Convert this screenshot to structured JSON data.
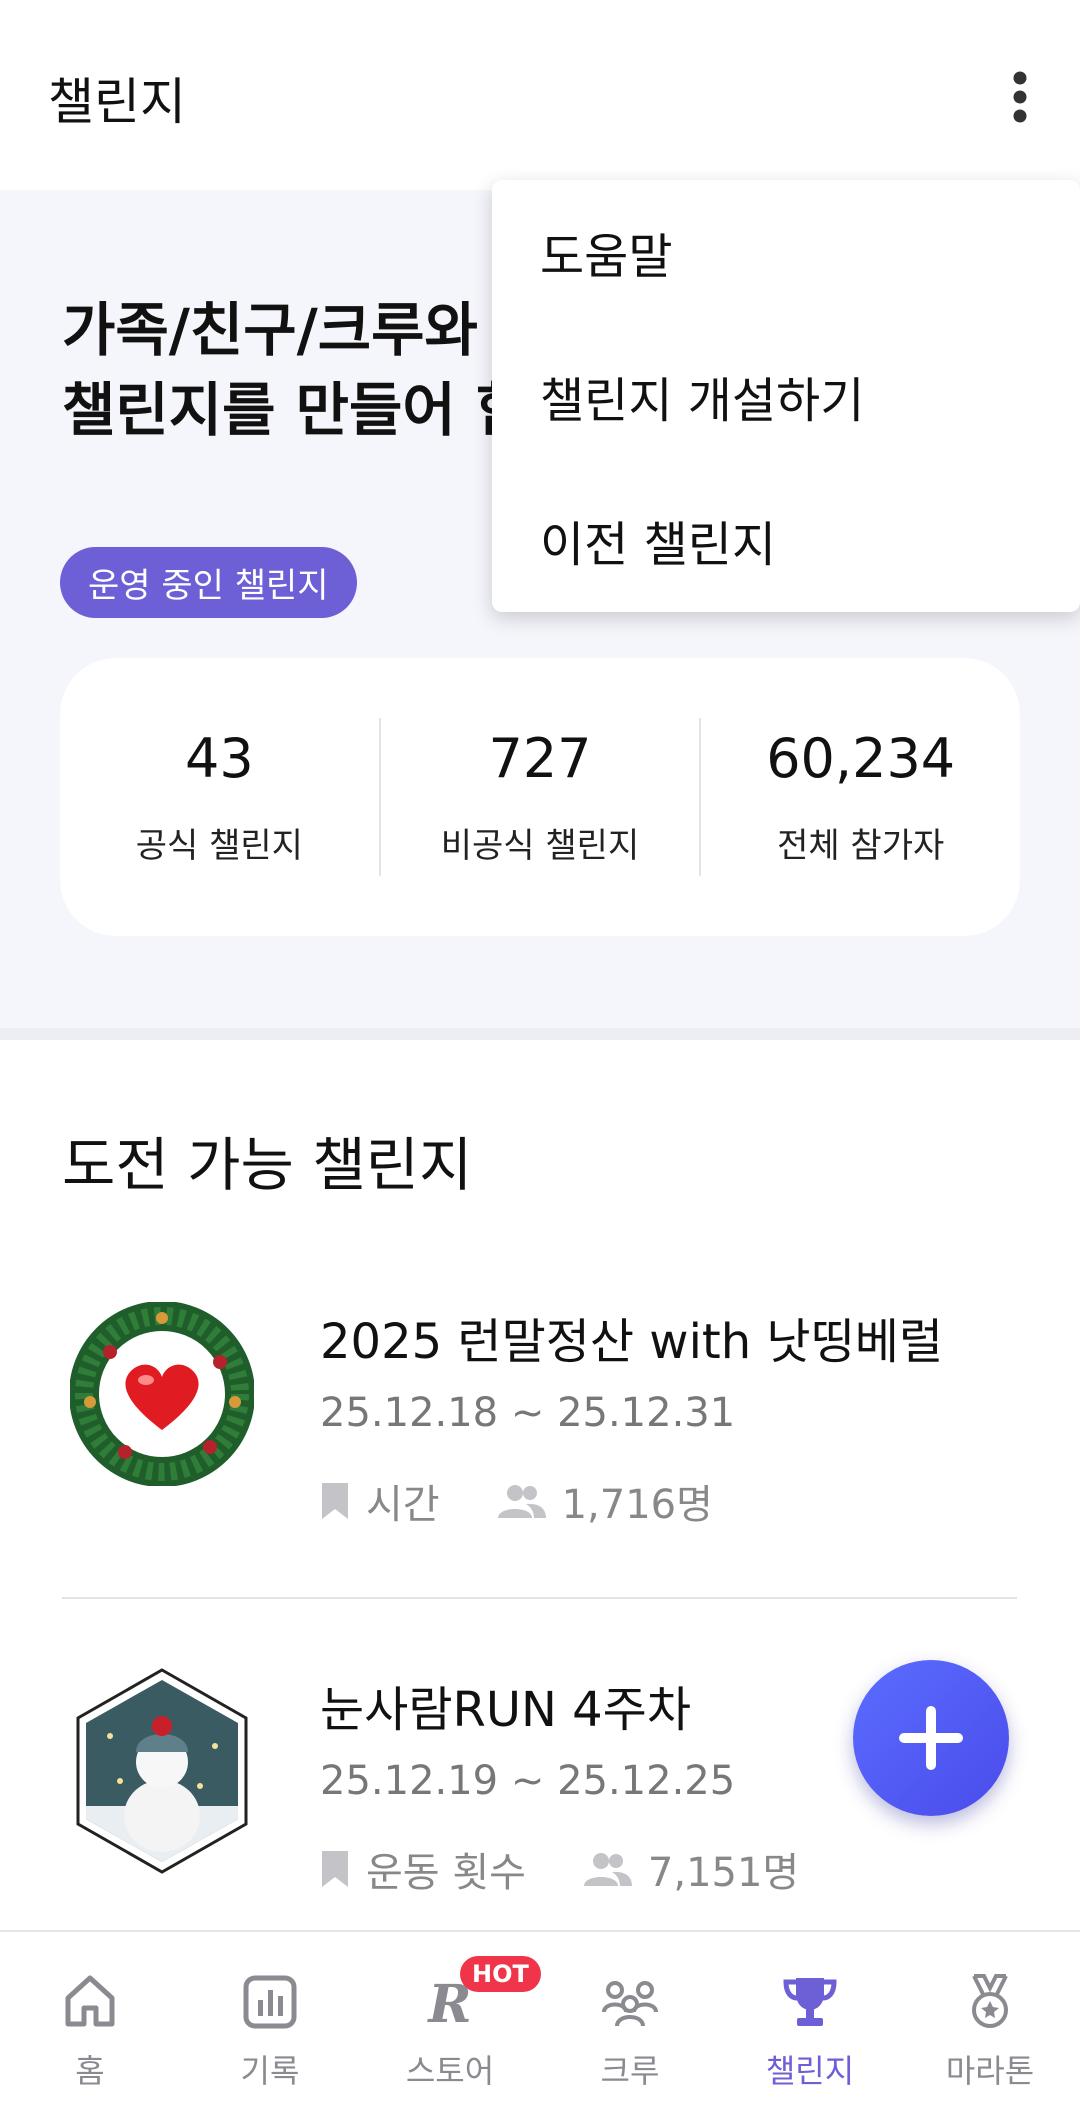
{
  "appbar": {
    "title": "챌린지",
    "more_icon": "more-vertical-icon"
  },
  "hero": {
    "headline_line1": "가족/친구/크루와",
    "headline_line2": "챌린지를 만들어 함",
    "badge": "운영 중인 챌린지"
  },
  "stats": [
    {
      "value": "43",
      "label": "공식 챌린지"
    },
    {
      "value": "727",
      "label": "비공식 챌린지"
    },
    {
      "value": "60,234",
      "label": "전체 참가자"
    }
  ],
  "section": {
    "title": "도전 가능 챌린지"
  },
  "challenges": [
    {
      "name": "2025 런말정산 with 낫띵베럴",
      "period": "25.12.18 ~ 25.12.31",
      "type": "시간",
      "participants": "1,716명",
      "thumb": "christmas-wreath-heart"
    },
    {
      "name": "눈사람RUN 4주차",
      "period": "25.12.19 ~ 25.12.25",
      "type": "운동 횟수",
      "participants": "7,151명",
      "thumb": "snowman-hexagon"
    }
  ],
  "menu": {
    "items": [
      "도움말",
      "챌린지 개설하기",
      "이전 챌린지"
    ]
  },
  "tabs": [
    {
      "label": "홈",
      "icon": "home-icon"
    },
    {
      "label": "기록",
      "icon": "stats-icon"
    },
    {
      "label": "스토어",
      "icon": "store-icon",
      "badge": "HOT"
    },
    {
      "label": "크루",
      "icon": "crew-icon"
    },
    {
      "label": "챌린지",
      "icon": "trophy-icon",
      "active": true
    },
    {
      "label": "마라톤",
      "icon": "medal-icon"
    }
  ],
  "colors": {
    "accent": "#6d5fd6",
    "fab": "#4f5cf5",
    "hot": "#f0354a",
    "hero_bg": "#f5f6fb"
  }
}
